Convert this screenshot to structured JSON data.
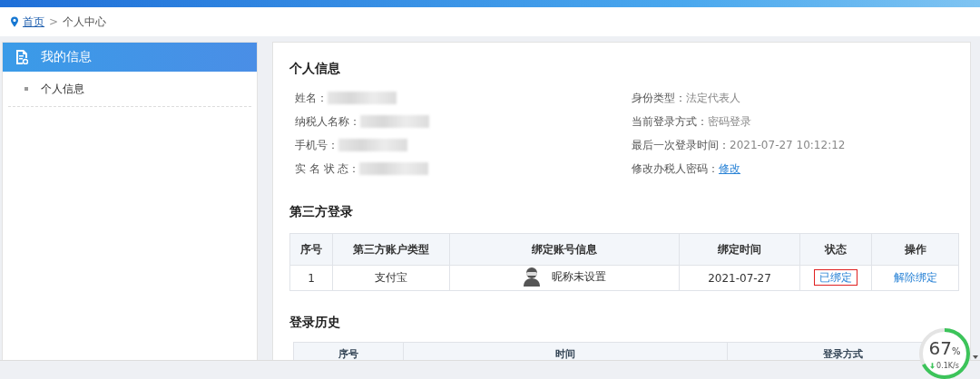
{
  "breadcrumb": {
    "home": "首页",
    "separator": ">",
    "current": "个人中心"
  },
  "sidebar": {
    "header": "我的信息",
    "items": [
      {
        "label": "个人信息",
        "selected": false
      }
    ]
  },
  "personal_info": {
    "title": "个人信息",
    "left_fields": [
      {
        "label": "姓名：",
        "kind": "redacted"
      },
      {
        "label": "纳税人名称：",
        "kind": "redacted"
      },
      {
        "label": "手机号：",
        "kind": "redacted"
      },
      {
        "label": "实 名 状 态：",
        "kind": "redacted"
      }
    ],
    "right_fields": [
      {
        "label": "身份类型：",
        "value": "法定代表人",
        "kind": "text"
      },
      {
        "label": "当前登录方式：",
        "value": "密码登录",
        "kind": "text"
      },
      {
        "label": "最后一次登录时间：",
        "value": "2021-07-27 10:12:12",
        "kind": "text"
      },
      {
        "label": "修改办税人密码：",
        "value": "修改",
        "kind": "link"
      }
    ]
  },
  "third_party": {
    "title": "第三方登录",
    "columns": [
      "序号",
      "第三方账户类型",
      "绑定账号信息",
      "绑定时间",
      "状态",
      "操作"
    ],
    "rows": [
      {
        "index": "1",
        "type": "支付宝",
        "account": "昵称未设置",
        "time": "2021-07-27",
        "status": "已绑定",
        "status_highlighted": true,
        "action": "解除绑定"
      }
    ]
  },
  "login_history": {
    "title": "登录历史",
    "columns": [
      "序号",
      "时间",
      "登录方式"
    ]
  },
  "speed_widget": {
    "percent": "67",
    "unit": "%",
    "speed": "0.1K/s",
    "level": 0.67
  }
}
